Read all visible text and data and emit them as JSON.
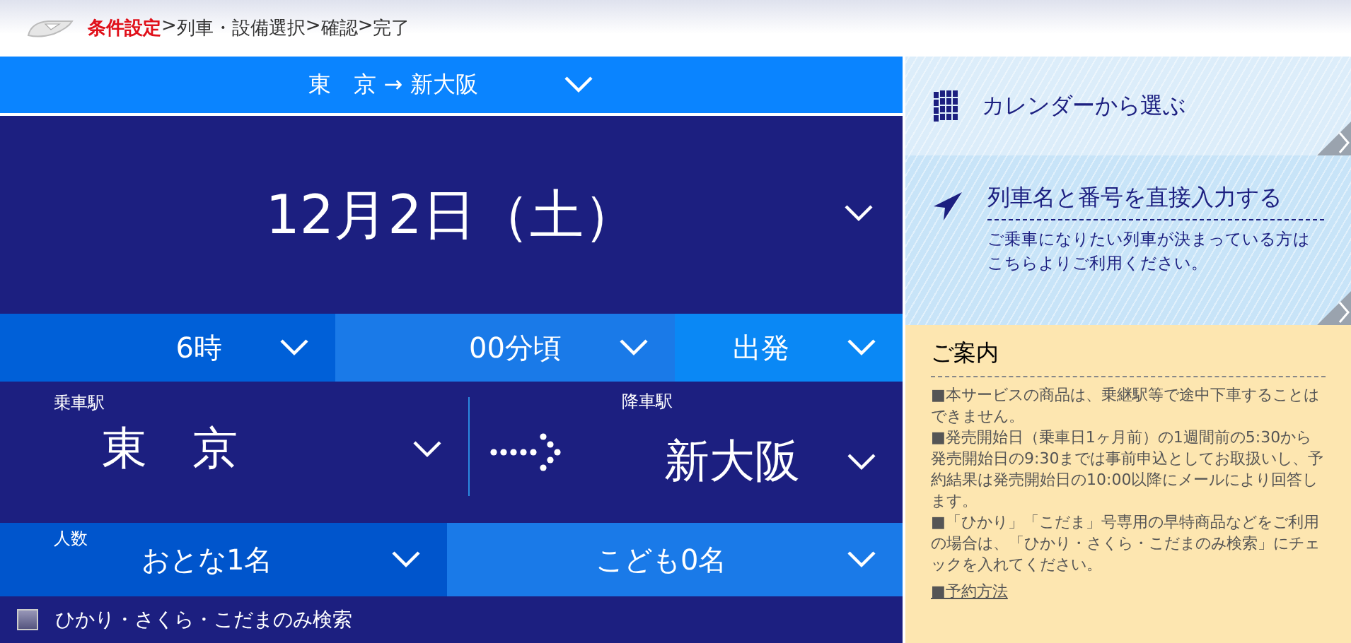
{
  "breadcrumb": [
    {
      "label": "条件設定",
      "selected": true
    },
    {
      "label": "列車・設備選択",
      "selected": false
    },
    {
      "label": "確認",
      "selected": false
    },
    {
      "label": "完了",
      "selected": false
    }
  ],
  "breadcrumb_separator": ">",
  "route": {
    "from": "東　京",
    "arrow": "→",
    "to": "新大阪"
  },
  "date": "12月2日（土）",
  "time": [
    {
      "value": "6時"
    },
    {
      "value": "00分頃"
    },
    {
      "value": "出発"
    }
  ],
  "stations": {
    "departure_label": "乗車駅",
    "departure": "東　京",
    "arrival_label": "降車駅",
    "arrival": "新大阪"
  },
  "passengers": {
    "label": "人数",
    "adults": "おとな1名",
    "children": "こども0名"
  },
  "filter": {
    "label": "ひかり・さくら・こだまのみ検索",
    "checked": false
  },
  "side": {
    "calendar": "カレンダーから選ぶ",
    "train_title": "列車名と番号を直接入力する",
    "train_desc": "ご乗車になりたい列車が決まっている方はこちらよりご利用ください。"
  },
  "info": {
    "title": "ご案内",
    "notes": [
      "■本サービスの商品は、乗継駅等で途中下車することはできません。",
      "■発売開始日（乗車日1ヶ月前）の1週間前の5:30から発売開始日の9:30までは事前申込としてお取扱いし、予約結果は発売開始日の10:00以降にメールにより回答します。",
      "■「ひかり」「こだま」号専用の早特商品などをご利用の場合は、「ひかり・さくら・こだまのみ検索」にチェックを入れてください。"
    ],
    "link": "■予約方法"
  }
}
